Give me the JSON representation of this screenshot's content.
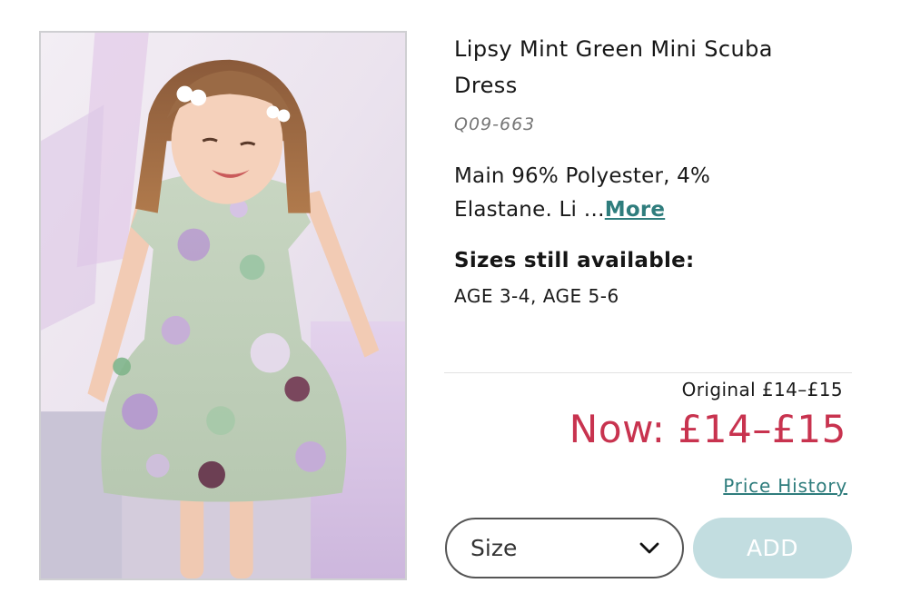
{
  "product": {
    "title": "Lipsy Mint Green Mini Scuba Dress",
    "sku": "Q09-663",
    "description_text": "Main 96% Polyester, 4% Elastane. Li …",
    "more_label": "More",
    "sizes_heading": "Sizes still available:",
    "sizes_available": "AGE 3-4, AGE 5-6"
  },
  "pricing": {
    "original": "Original £14–£15",
    "now": "Now: £14–£15",
    "price_history_label": "Price History",
    "now_color": "#c8334f"
  },
  "actions": {
    "size_placeholder": "Size",
    "add_label": "ADD",
    "add_button_color": "#c2dde0",
    "link_color": "#2f7d7d"
  },
  "image": {
    "subject": "girl-in-floral-mint-dress-photo"
  }
}
